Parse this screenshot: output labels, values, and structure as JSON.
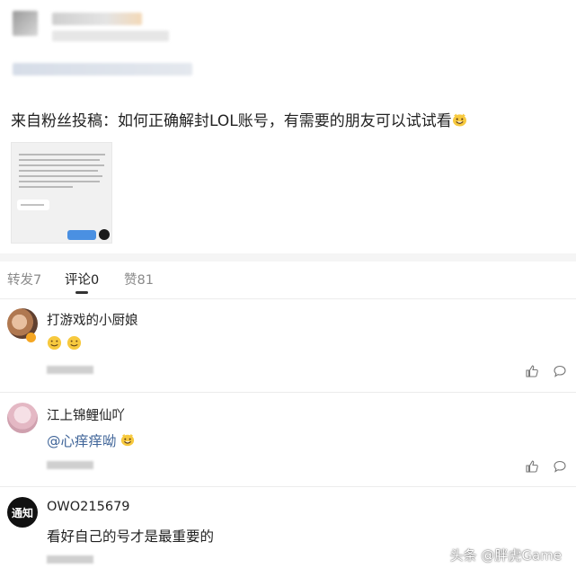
{
  "post": {
    "text": "来自粉丝投稿：如何正确解封LOL账号，有需要的朋友可以试试看"
  },
  "tabs": [
    {
      "label": "转发7"
    },
    {
      "label": "评论0"
    },
    {
      "label": "赞81"
    }
  ],
  "comments": [
    {
      "username": "打游戏的小厨娘",
      "text": ""
    },
    {
      "username": "江上锦鲤仙吖",
      "text": "@心痒痒呦"
    },
    {
      "username": "OWO215679",
      "avatar_text": "通知",
      "text": "看好自己的号才是最重要的"
    }
  ],
  "icons": [
    "like-icon",
    "comment-icon"
  ],
  "watermark": "头条 @胖虎Game",
  "colors": {
    "mention": "#406599",
    "emoji_yellow": "#f7c93e"
  }
}
